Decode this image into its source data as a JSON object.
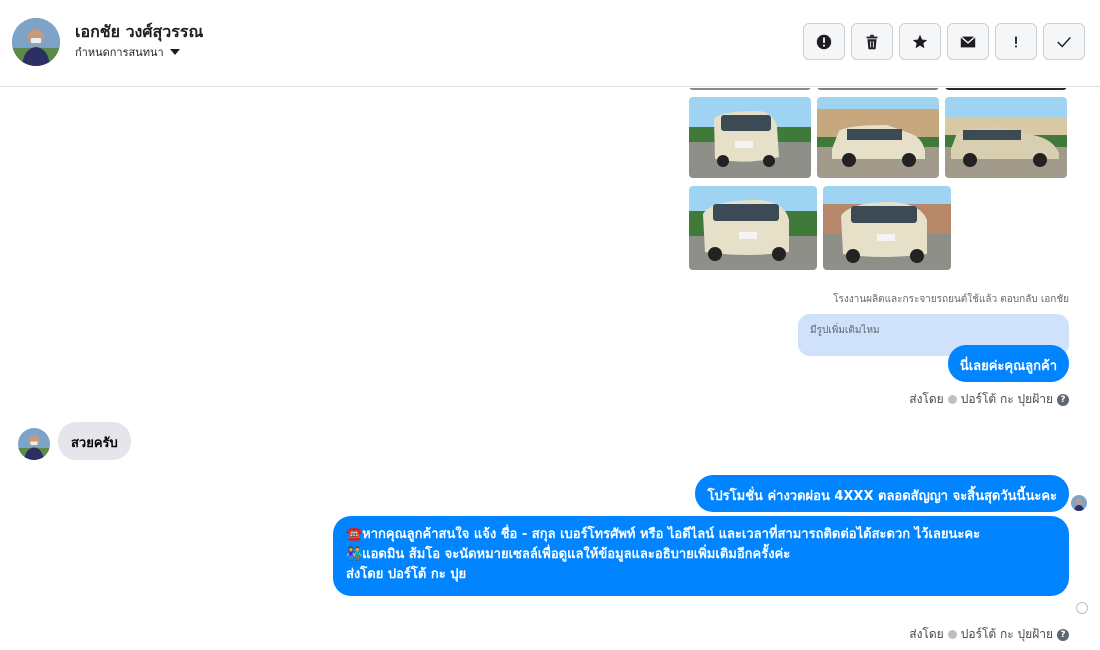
{
  "header": {
    "contact_name": "เอกชัย วงศ์สุวรรณ",
    "status_label": "กำหนดการสนทนา",
    "actions": [
      "report-icon",
      "trash-icon",
      "star-icon",
      "mail-icon",
      "exclamation-icon",
      "check-icon"
    ]
  },
  "thread": {
    "reply_meta": "โรงงานผลิตและกระจายรถยนต์ใช้แล้ว ตอบกลับ เอกชัย",
    "quoted_text": "มีรูปเพิ่มเติมไหม",
    "reply_bubble": "นี่เลยค่ะคุณลูกค้า",
    "sent_by_1": "ส่งโดย",
    "sent_by_name_1": "ปอร์โต้ กะ ปุยฝ้าย",
    "incoming_message": "สวยครับ",
    "promo_message": "โปรโมชั่น ค่างวดผ่อน 4XXX ตลอดสัญญา จะสิ้นสุดวันนี้นะคะ",
    "long_line_1": "☎️หากคุณลูกค้าสนใจ แจ้ง ชื่อ - สกุล เบอร์โทรศัพท์ หรือ ไอดีไลน์ และเวลาที่สามารถติดต่อได้สะดวก ไว้เลยนะคะ",
    "long_line_2": "👫แอดมิน ส้มโอ จะนัดหมายเซลล์เพื่อดูแลให้ข้อมูลและอธิบายเพิ่มเติมอีกครั้งค่ะ",
    "long_line_3": "ส่งโดย ปอร์โต้ กะ ปุย",
    "sent_by_2": "ส่งโดย",
    "sent_by_name_2": "ปอร์โต้ กะ ปุยฝ้าย"
  },
  "colors": {
    "outgoing": "#0084ff",
    "incoming": "#e4e6eb",
    "quote": "#cfe1fb"
  }
}
